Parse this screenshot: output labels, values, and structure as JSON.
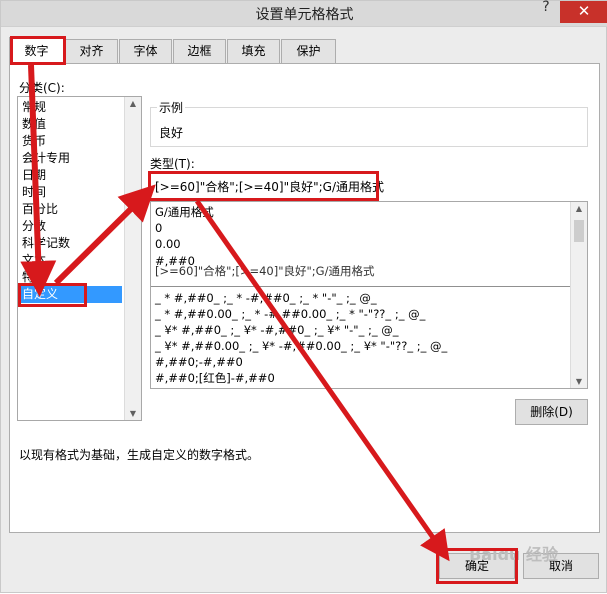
{
  "window": {
    "title": "设置单元格格式",
    "help_label": "?",
    "close_label": "✕"
  },
  "tabs": [
    {
      "label": "数字",
      "active": true
    },
    {
      "label": "对齐"
    },
    {
      "label": "字体"
    },
    {
      "label": "边框"
    },
    {
      "label": "填充"
    },
    {
      "label": "保护"
    }
  ],
  "category": {
    "label": "分类(C):",
    "items": [
      "常规",
      "数值",
      "货币",
      "会计专用",
      "日期",
      "时间",
      "百分比",
      "分数",
      "科学记数",
      "文本",
      "特殊",
      "自定义"
    ],
    "selected": "自定义"
  },
  "sample": {
    "label": "示例",
    "value": "良好"
  },
  "type": {
    "label": "类型(T):",
    "value": "[>=60]\"合格\";[>=40]\"良好\";G/通用格式",
    "list_top": [
      "G/通用格式",
      "0",
      "0.00",
      "#,##0"
    ],
    "list_drag_ghost": "[>=60]\"合格\";[>=40]\"良好\";G/通用格式",
    "list_bottom": [
      "_ * #,##0_ ;_ * -#,##0_ ;_ * \"-\"_ ;_ @_",
      "_ * #,##0.00_ ;_ * -#,##0.00_ ;_ * \"-\"??_ ;_ @_",
      "_ ¥* #,##0_ ;_ ¥* -#,##0_ ;_ ¥* \"-\"_ ;_ @_",
      "_ ¥* #,##0.00_ ;_ ¥* -#,##0.00_ ;_ ¥* \"-\"??_ ;_ @_",
      "#,##0;-#,##0",
      "#,##0;[红色]-#,##0"
    ]
  },
  "buttons": {
    "delete": "删除(D)",
    "ok": "确定",
    "cancel": "取消"
  },
  "hint": "以现有格式为基础，生成自定义的数字格式。",
  "watermark": "Baidu 经验",
  "colors": {
    "annotation_red": "#d7191c",
    "selection_blue": "#3399ff",
    "close_red": "#c8312a"
  }
}
